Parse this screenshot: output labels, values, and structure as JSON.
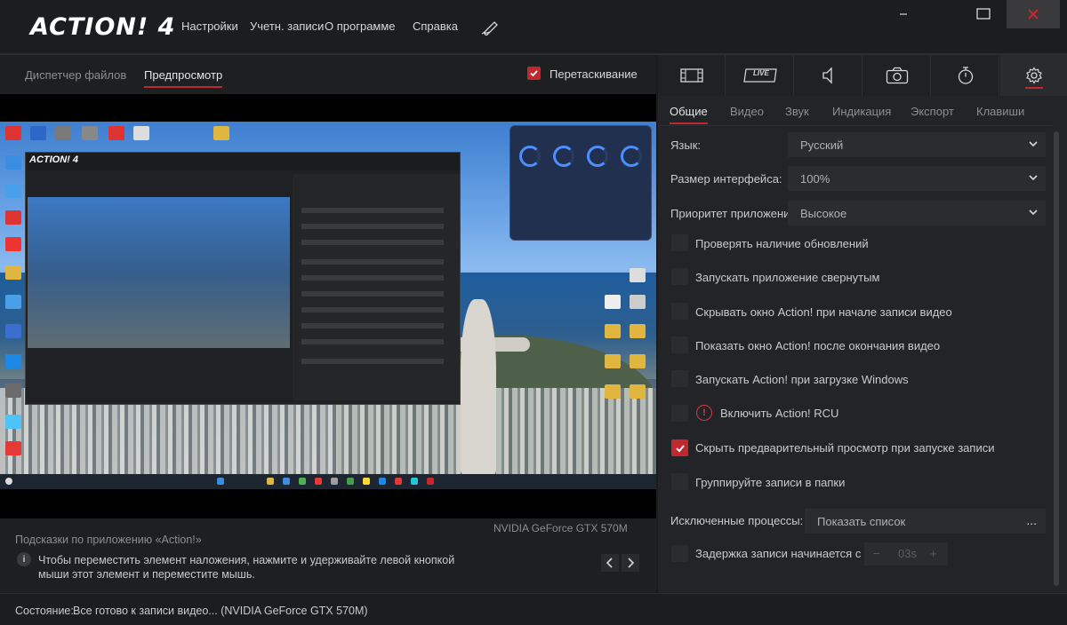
{
  "app": {
    "logo_text": "ACTION! 4",
    "menu": [
      "Настройки",
      "Учетн. записи",
      "О программе",
      "Справка"
    ],
    "accent_color": "#c0282d"
  },
  "left": {
    "tabs": [
      "Диспетчер файлов",
      "Предпросмотр"
    ],
    "drag_label": "Перетаскивание",
    "gpu": "NVIDIA GeForce GTX 570M",
    "tips_title": "Подсказки по приложению «Action!»",
    "tips_text": "Чтобы переместить элемент наложения, нажмите и удерживайте левой кнопкой мыши этот элемент и переместите мышь."
  },
  "right": {
    "mode_icons": [
      "film-icon",
      "live-icon",
      "speaker-icon",
      "camera-icon",
      "timer-icon",
      "gear-icon"
    ],
    "live_label": "LIVE",
    "subtabs": [
      "Общие",
      "Видео",
      "Звук",
      "Индикация",
      "Экспорт",
      "Клавиши"
    ],
    "language_label": "Язык:",
    "language_value": "Русский",
    "size_label": "Размер интерфейса:",
    "size_value": "100%",
    "priority_label": "Приоритет приложения",
    "priority_value": "Высокое",
    "options": [
      {
        "label": "Проверять наличие обновлений",
        "checked": false
      },
      {
        "label": "Запускать приложение свернутым",
        "checked": false
      },
      {
        "label": "Скрывать окно Action! при начале записи видео",
        "checked": false
      },
      {
        "label": "Показать окно Action! после окончания видео",
        "checked": false
      },
      {
        "label": "Запускать Action! при загрузке Windows",
        "checked": false
      },
      {
        "label": "Включить Action! RCU",
        "checked": false
      },
      {
        "label": "Скрыть предварительный просмотр при запуске записи",
        "checked": true
      },
      {
        "label": "Группируйте записи в папки",
        "checked": false
      }
    ],
    "excluded_label": "Исключенные процессы:",
    "excluded_value": "Показать список",
    "excluded_more": "...",
    "delay_label": "Задержка записи начинается с",
    "delay_value": "03s",
    "delay_minus": "−",
    "delay_plus": "+"
  },
  "status": {
    "label": "Состояние:",
    "text": "Все готово к записи видео...  (NVIDIA GeForce GTX 570M)"
  }
}
